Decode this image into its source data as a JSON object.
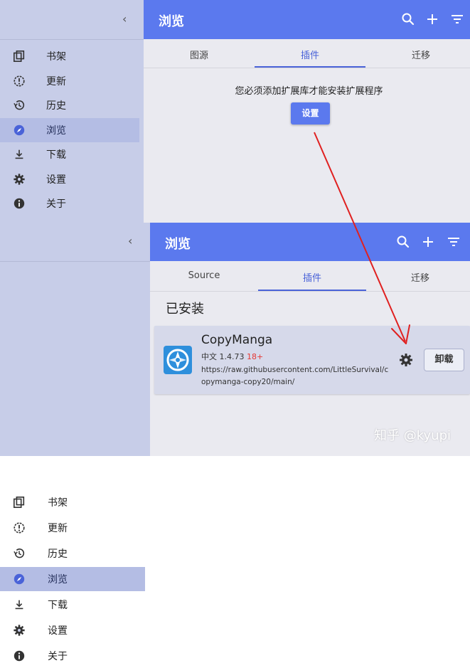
{
  "colors": {
    "accent": "#5b79ee",
    "sidebar_bg": "#c7cde8",
    "sidebar_active": "#b4bde4",
    "tab_active": "#4a63d8",
    "nsfw_badge": "#e53935",
    "arrow": "#e02020"
  },
  "top": {
    "sidebar": {
      "items": [
        {
          "label": "书架",
          "icon": "library-icon"
        },
        {
          "label": "更新",
          "icon": "alert-circle-icon"
        },
        {
          "label": "历史",
          "icon": "history-icon"
        },
        {
          "label": "浏览",
          "icon": "compass-icon",
          "active": true
        },
        {
          "label": "下载",
          "icon": "download-icon"
        },
        {
          "label": "设置",
          "icon": "gear-icon"
        },
        {
          "label": "关于",
          "icon": "info-icon"
        }
      ]
    },
    "header": {
      "title": "浏览"
    },
    "tabs": [
      {
        "label": "图源"
      },
      {
        "label": "插件",
        "active": true
      },
      {
        "label": "迁移"
      }
    ],
    "message": "您必须添加扩展库才能安装扩展程序",
    "settings_button": "设置"
  },
  "bottom": {
    "sidebar": {
      "items": [
        {
          "label": "书架",
          "icon": "library-icon"
        },
        {
          "label": "更新",
          "icon": "alert-circle-icon"
        },
        {
          "label": "历史",
          "icon": "history-icon"
        },
        {
          "label": "浏览",
          "icon": "compass-icon",
          "active": true
        },
        {
          "label": "下载",
          "icon": "download-icon"
        },
        {
          "label": "设置",
          "icon": "gear-icon"
        },
        {
          "label": "关于",
          "icon": "info-icon"
        }
      ]
    },
    "header": {
      "title": "浏览"
    },
    "tabs": [
      {
        "label": "Source"
      },
      {
        "label": "插件",
        "active": true
      },
      {
        "label": "迁移"
      }
    ],
    "section_title": "已安装",
    "extension": {
      "name": "CopyManga",
      "lang": "中文",
      "version": "1.4.73",
      "badge": "18+",
      "url_line1": "https://raw.githubusercontent.com/LittleSurvival/c",
      "url_line2": "opymanga-copy20/main/",
      "uninstall_label": "卸载"
    }
  },
  "watermark": "知乎 @kyupi"
}
